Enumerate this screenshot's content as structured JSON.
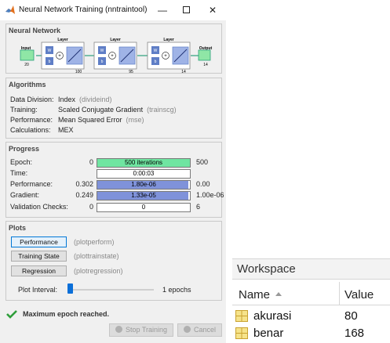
{
  "window": {
    "title": "Neural Network Training (nntraintool)",
    "controls": {
      "minimize": "—",
      "close": "✕"
    }
  },
  "network": {
    "title": "Neural Network",
    "input": {
      "label": "Input",
      "size": "20"
    },
    "layers": [
      {
        "label": "Layer",
        "size": "100"
      },
      {
        "label": "Layer",
        "size": "95"
      },
      {
        "label": "Layer",
        "size": "14"
      }
    ],
    "output": {
      "label": "Output",
      "size": "14"
    },
    "weight_label": "W",
    "bias_label": "b",
    "sum_label": "+"
  },
  "algorithms": {
    "title": "Algorithms",
    "rows": [
      {
        "label": "Data Division:",
        "value": "Index",
        "sub": "(divideind)"
      },
      {
        "label": "Training:",
        "value": "Scaled Conjugate Gradient",
        "sub": "(trainscg)"
      },
      {
        "label": "Performance:",
        "value": "Mean Squared Error",
        "sub": "(mse)"
      },
      {
        "label": "Calculations:",
        "value": "MEX",
        "sub": ""
      }
    ]
  },
  "progress": {
    "title": "Progress",
    "rows": [
      {
        "label": "Epoch:",
        "start": "0",
        "bar_text": "500 iterations",
        "end": "500",
        "fill": 1.0,
        "color": "#6fe5a1"
      },
      {
        "label": "Time:",
        "start": "",
        "bar_text": "0:00:03",
        "end": "",
        "fill": 0.0,
        "color": "#ffffff"
      },
      {
        "label": "Performance:",
        "start": "0.302",
        "bar_text": "1.80e-06",
        "end": "0.00",
        "fill": 0.98,
        "color": "#7f92da"
      },
      {
        "label": "Gradient:",
        "start": "0.249",
        "bar_text": "1.33e-05",
        "end": "1.00e-06",
        "fill": 0.98,
        "color": "#7f92da"
      },
      {
        "label": "Validation Checks:",
        "start": "0",
        "bar_text": "0",
        "end": "6",
        "fill": 0.0,
        "color": "#ffffff"
      }
    ]
  },
  "plots": {
    "title": "Plots",
    "buttons": [
      {
        "label": "Performance",
        "desc": "(plotperform)"
      },
      {
        "label": "Training State",
        "desc": "(plottrainstate)"
      },
      {
        "label": "Regression",
        "desc": "(plotregression)"
      }
    ],
    "interval_label": "Plot Interval:",
    "interval_value": "1 epochs",
    "interval_level": 0.0
  },
  "status": {
    "message": "Maximum epoch reached."
  },
  "buttons": {
    "stop": "Stop Training",
    "cancel": "Cancel"
  },
  "workspace": {
    "title": "Workspace",
    "columns": {
      "name": "Name",
      "value": "Value"
    },
    "variables": [
      {
        "name": "akurasi",
        "value": "80"
      },
      {
        "name": "benar",
        "value": "168"
      }
    ]
  },
  "colors": {
    "epoch_bar": "#6fe5a1",
    "progress_bar": "#7f92da",
    "layer_box": "#9fb3e6",
    "io_box": "#8fe6a6",
    "check": "#2e9e3a",
    "focus": "#0078d7"
  }
}
